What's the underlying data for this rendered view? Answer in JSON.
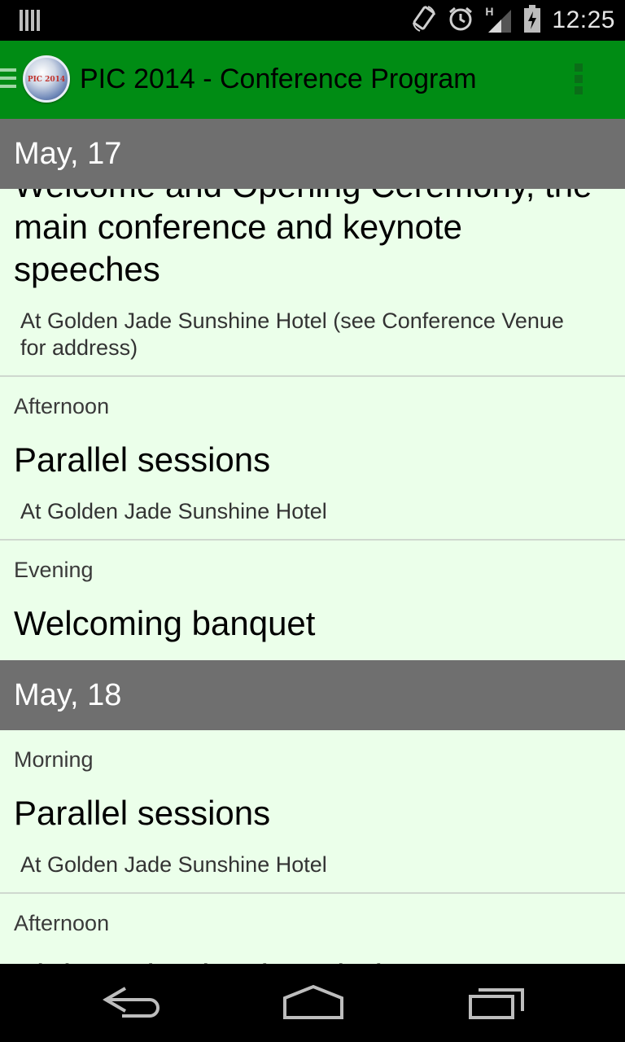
{
  "status_bar": {
    "time": "12:25",
    "network_type": "H",
    "icons": [
      "notification-bars-icon",
      "screen-rotate-icon",
      "alarm-clock-icon",
      "signal-strength-icon",
      "battery-icon"
    ]
  },
  "action_bar": {
    "title": "PIC 2014 - Conference Program",
    "logo_text": "PIC 2014"
  },
  "days": [
    {
      "label": "May, 17",
      "events": [
        {
          "title_line_1": "Welcome and Opening Ceremony, the",
          "title_line_2": "main conference and keynote",
          "title_line_3": "speeches",
          "location_line_1": "At Golden Jade Sunshine Hotel (see Conference Venue",
          "location_line_2": "for address)"
        },
        {
          "period": "Afternoon",
          "title": "Parallel sessions",
          "location": "At Golden Jade Sunshine Hotel"
        },
        {
          "period": "Evening",
          "title": "Welcoming banquet"
        }
      ]
    },
    {
      "label": "May, 18",
      "events": [
        {
          "period": "Morning",
          "title": "Parallel sessions",
          "location": "At Golden Jade Sunshine Hotel"
        },
        {
          "period": "Afternoon",
          "title": "Sightseeing in Shanghai"
        }
      ]
    }
  ],
  "colors": {
    "action_bar": "#008c14",
    "day_header": "#6f6f6f",
    "list_background": "#ebffea"
  },
  "nav_bar": {
    "icons": [
      "back-icon",
      "home-icon",
      "recent-apps-icon"
    ]
  }
}
